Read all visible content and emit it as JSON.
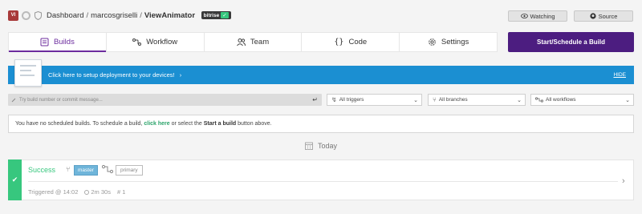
{
  "topbar": {
    "avatar_initials": "VI",
    "breadcrumb_root": "Dashboard",
    "breadcrumb_owner": "marcosgriselli",
    "breadcrumb_app": "ViewAnimator",
    "badge_label": "bitrise",
    "badge_check": "✓",
    "watching_label": "Watching",
    "source_label": "Source"
  },
  "tabs": [
    {
      "label": "Builds",
      "icon": "builds-icon"
    },
    {
      "label": "Workflow",
      "icon": "workflow-icon"
    },
    {
      "label": "Team",
      "icon": "team-icon"
    },
    {
      "label": "Code",
      "icon": "code-icon"
    },
    {
      "label": "Settings",
      "icon": "gear-icon"
    }
  ],
  "tab_code_glyph": "{}",
  "start_button": "Start/Schedule a Build",
  "banner": {
    "text": "Click here to setup deployment to your devices!",
    "chevron": "›",
    "hide": "HIDE"
  },
  "filters": {
    "search_placeholder": "Try build number or commit message...",
    "triggers": "All triggers",
    "branches": "All branches",
    "workflows": "All workflows"
  },
  "notice": {
    "prefix": "You have no scheduled builds. To schedule a build,",
    "link": "click here",
    "middle": "or select the",
    "bold": "Start a build",
    "suffix": "button above."
  },
  "day_label": "Today",
  "build": {
    "status": "Success",
    "branch": "master",
    "workflow": "primary",
    "triggered": "Triggered @ 14:02",
    "duration": "2m 30s",
    "number": "# 1"
  },
  "colors": {
    "accent_purple": "#6c2c9e",
    "start_button": "#4c1d80",
    "banner_blue": "#1b8fd2",
    "success_green": "#37c77e"
  }
}
